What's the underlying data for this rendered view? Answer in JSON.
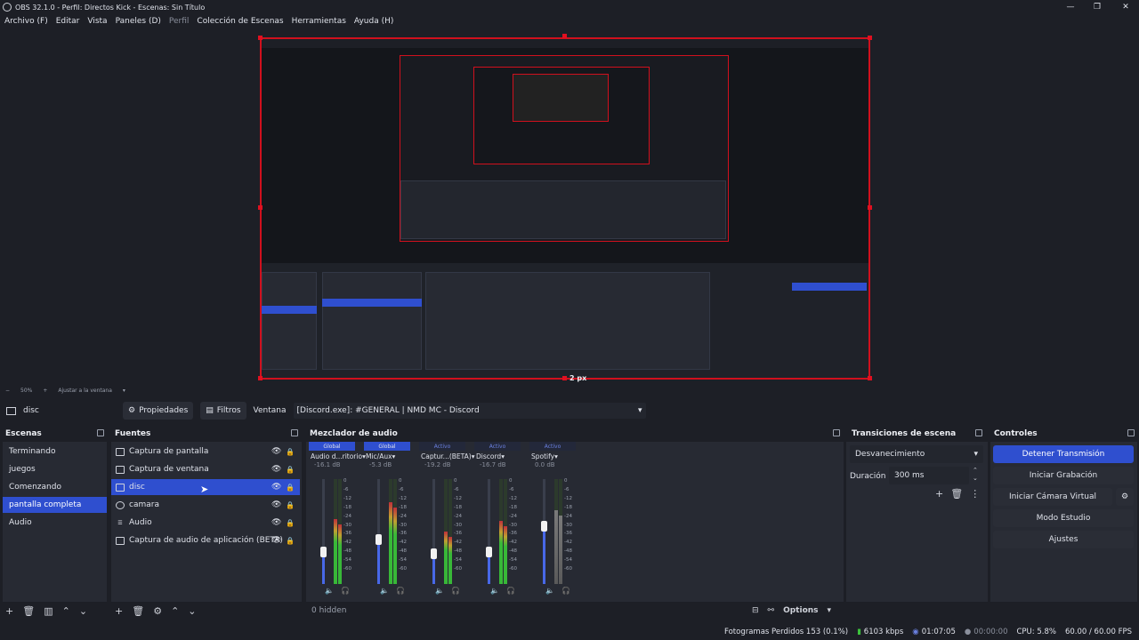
{
  "window": {
    "title": "OBS 32.1.0 - Perfil: Directos Kick - Escenas: Sin Título"
  },
  "menu": [
    "Archivo (F)",
    "Editar",
    "Vista",
    "Paneles (D)",
    "Perfil",
    "Colección de Escenas",
    "Herramientas",
    "Ayuda (H)"
  ],
  "preview": {
    "size_label": "2 px",
    "zoom": "50%",
    "zoom_mode": "Ajustar a la ventana"
  },
  "props": {
    "source_name": "disc",
    "properties_label": "Propiedades",
    "filters_label": "Filtros",
    "window_label": "Ventana",
    "window_value": "[Discord.exe]: #GENERAL | NMD MC - Discord"
  },
  "scenes": {
    "title": "Escenas",
    "items": [
      "Terminando",
      "juegos",
      "Comenzando",
      "pantalla completa",
      "Audio"
    ],
    "selected": "pantalla completa"
  },
  "sources": {
    "title": "Fuentes",
    "items": [
      "Captura de pantalla",
      "Captura de ventana",
      "disc",
      "camara",
      "Audio",
      "Captura de audio de aplicación (BETA)"
    ],
    "selected": "disc"
  },
  "mixer": {
    "title": "Mezclador de audio",
    "hidden_label": "0 hidden",
    "options_label": "Options",
    "channels": [
      {
        "tag": "Global",
        "name": "Audio d...ritorio",
        "db": "-16.1 dB",
        "volume": 0.55,
        "level": 0.62,
        "muted": false
      },
      {
        "tag": "Global",
        "name": "Mic/Aux",
        "db": "-5.3 dB",
        "volume": 0.77,
        "level": 0.78,
        "muted": false
      },
      {
        "tag": "Activo",
        "name": "Captur...(BETA)",
        "db": "-19.2 dB",
        "volume": 0.52,
        "level": 0.5,
        "muted": false
      },
      {
        "tag": "Activo",
        "name": "Discord",
        "db": "-16.7 dB",
        "volume": 0.55,
        "level": 0.6,
        "muted": false
      },
      {
        "tag": "Activo",
        "name": "Spotify",
        "db": "0.0 dB",
        "volume": 1.0,
        "level": 0.7,
        "muted": true
      }
    ],
    "scale": [
      "0",
      "-6",
      "-12",
      "-18",
      "-24",
      "-30",
      "-36",
      "-42",
      "-48",
      "-54",
      "-60"
    ]
  },
  "transitions": {
    "title": "Transiciones de escena",
    "type": "Desvanecimiento",
    "duration_label": "Duración",
    "duration": "300 ms"
  },
  "controls": {
    "title": "Controles",
    "stop_stream": "Detener Transmisión",
    "start_record": "Iniciar Grabación",
    "virtual_cam": "Iniciar Cámara Virtual",
    "studio_mode": "Modo Estudio",
    "settings": "Ajustes"
  },
  "status": {
    "dropped": "Fotogramas Perdidos 153 (0.1%)",
    "bitrate": "6103 kbps",
    "stream_time": "01:07:05",
    "rec_time": "00:00:00",
    "cpu": "CPU: 5.8%",
    "fps": "60.00 / 60.00 FPS"
  },
  "colors": {
    "accent": "#2f4fcf",
    "bg": "#1d1f26",
    "panel": "#272a33",
    "selection_border": "#d0101d"
  }
}
